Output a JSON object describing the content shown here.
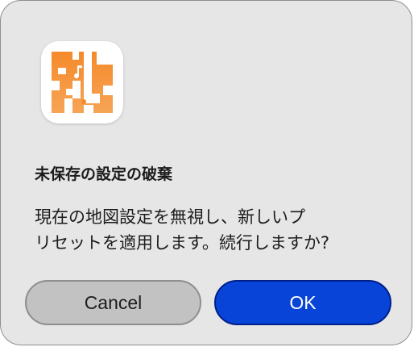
{
  "dialog": {
    "icon_name": "app-icon",
    "title": "未保存の設定の破棄",
    "message_line1": "現在の地図設定を無視し、新しいプ",
    "message_line2": "リセットを適用します。続行しますか?",
    "cancel_label": "Cancel",
    "ok_label": "OK"
  },
  "colors": {
    "dialog_background": "#e6e6e6",
    "ok_button": "#0844d8",
    "cancel_button": "#c2c2c2",
    "icon_orange": "#f08a2c"
  }
}
